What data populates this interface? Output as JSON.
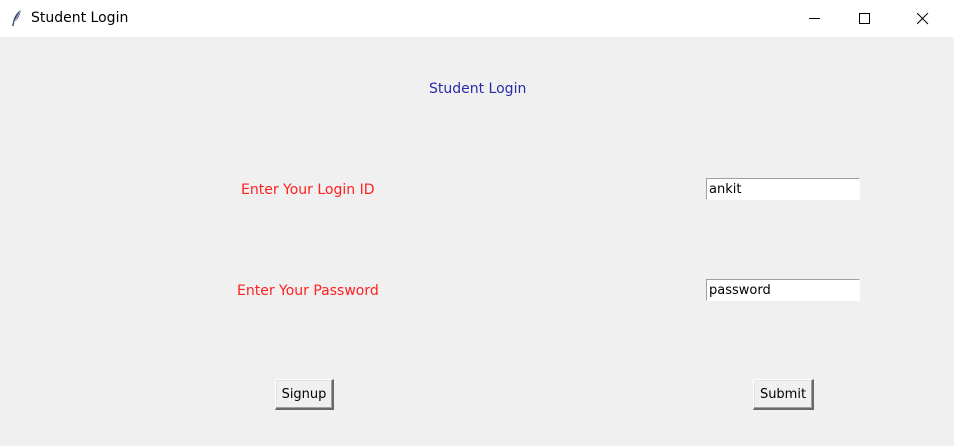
{
  "window": {
    "title": "Student Login",
    "icon": "feather-icon",
    "controls": [
      "minimize-icon",
      "maximize-icon",
      "close-icon"
    ]
  },
  "form": {
    "heading": "Student Login",
    "login_label": "Enter Your Login ID",
    "login_value": "ankit",
    "password_label": "Enter Your Password",
    "password_value": "password",
    "signup_label": "Signup",
    "submit_label": "Submit"
  },
  "colors": {
    "heading": "#2a2aa8",
    "labels": "#ff2020",
    "background": "#f0f0f0"
  }
}
